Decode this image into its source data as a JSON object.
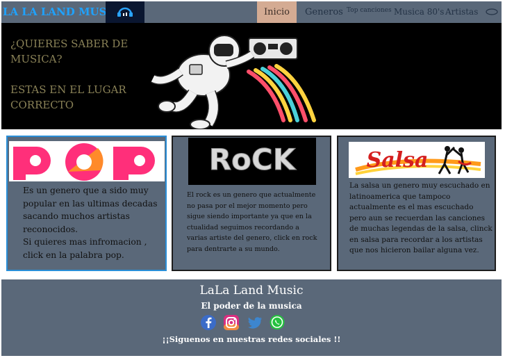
{
  "nav": {
    "brand": "LA LA LAND MUSIC",
    "items": [
      {
        "label": "Inicio",
        "active": true
      },
      {
        "label": "Generos"
      },
      {
        "label": "Top canciones"
      },
      {
        "label": "Musica 80's"
      },
      {
        "label": "Artistas"
      }
    ]
  },
  "hero": {
    "line1": "¿QUIERES SABER DE MUSICA?",
    "line2": "ESTAS EN EL LUGAR CORRECTO"
  },
  "cards": [
    {
      "genre": "POP",
      "text": "Es un genero que a sido muy popular en las ultimas decadas sacando muchos artistas reconocidos.",
      "text2": "Si quieres mas infromacion , click en la palabra pop."
    },
    {
      "genre": "RoCK",
      "text": "El rock es un genero que actualmente no pasa por el mejor momento pero sigue siendo importante ya que en la ctualidad seguimos recordando a varias artiste del genero, click en rock para dentrarte a su mundo."
    },
    {
      "genre": "Salsa",
      "text": "La salsa un genero muy escuchado en latinoamerica que tampoco actualmente es el mas escuchado pero aun se recuerdan las canciones de muchas legendas de la salsa, clinck en salsa para recordar a los artistas que nos hicieron bailar alguna vez."
    }
  ],
  "footer": {
    "title": "LaLa Land Music",
    "subtitle": "El poder de la musica",
    "follow": "¡¡Siguenos en nuestras redes sociales !!"
  },
  "colors": {
    "nav_bg": "#5a6879",
    "brand": "#1fa2ff",
    "active_tab": "#d4ab93",
    "hero_bg": "#000000",
    "hero_text": "#8a8257"
  }
}
